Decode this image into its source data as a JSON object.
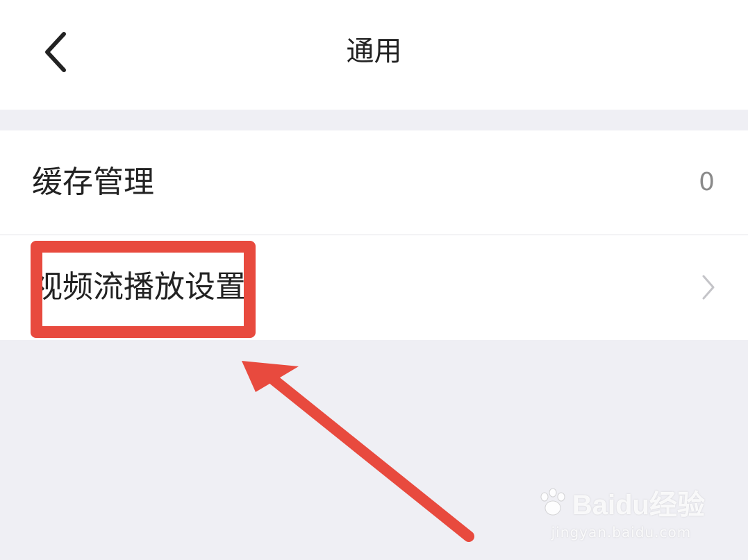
{
  "header": {
    "title": "通用",
    "back_icon": "chevron-left-icon"
  },
  "settings": [
    {
      "label": "缓存管理",
      "value": "0"
    },
    {
      "label": "视频流播放设置",
      "chevron_icon": "chevron-right-icon"
    }
  ],
  "watermark": {
    "logo_text": "Baidu经验",
    "url": "jingyan.baidu.com"
  },
  "colors": {
    "background": "#efeff4",
    "surface": "#ffffff",
    "annotation": "#e84a3e",
    "secondary_text": "#8a8a8a"
  }
}
